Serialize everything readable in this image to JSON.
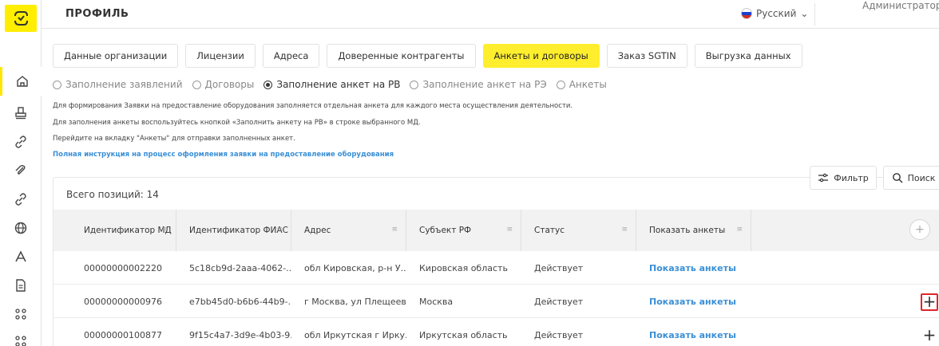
{
  "header": {
    "title": "ПРОФИЛЬ",
    "language": "Русский",
    "user": "Администратор"
  },
  "sidebar": {
    "icons": [
      "home-icon",
      "stamp-icon",
      "link-icon",
      "paperclip-icon",
      "link-icon",
      "globe-icon",
      "user-icon",
      "document-icon",
      "grid-icon",
      "grid-icon"
    ],
    "active_index": 0
  },
  "tabs": [
    {
      "label": "Данные организации",
      "active": false
    },
    {
      "label": "Лицензии",
      "active": false
    },
    {
      "label": "Адреса",
      "active": false
    },
    {
      "label": "Доверенные контрагенты",
      "active": false
    },
    {
      "label": "Анкеты и договоры",
      "active": true
    },
    {
      "label": "Заказ SGTIN",
      "active": false
    },
    {
      "label": "Выгрузка данных",
      "active": false
    }
  ],
  "radios": [
    {
      "label": "Заполнение заявлений",
      "checked": false
    },
    {
      "label": "Договоры",
      "checked": false
    },
    {
      "label": "Заполнение анкет на РВ",
      "checked": true
    },
    {
      "label": "Заполнение анкет на РЭ",
      "checked": false
    },
    {
      "label": "Анкеты",
      "checked": false
    }
  ],
  "info": {
    "line1": "Для формирования Заявки на предоставление оборудования заполняется отдельная анкета для каждого места осуществления деятельности.",
    "line2": "Для заполнения анкеты воспользуйтесь кнопкой «Заполнить анкету на РВ» в строке выбранного МД.",
    "line3": "Перейдите на вкладку \"Анкеты\" для отправки заполненных анкет.",
    "link": "Полная инструкция на процесс оформления заявки на предоставление оборудования"
  },
  "toolbar": {
    "filter": "Фильтр",
    "search": "Поиск"
  },
  "table": {
    "total": "Всего позиций: 14",
    "columns": [
      "Идентификатор МД",
      "Идентификатор ФИАС",
      "Адрес",
      "Субъект РФ",
      "Статус",
      "Показать анкеты"
    ],
    "rows": [
      {
        "md": "00000000002220",
        "fias": "5c18cb9d-2aaa-4062-...",
        "address": "обл Кировская, р-н У...",
        "subject": "Кировская область",
        "status": "Действует",
        "show": "Показать анкеты",
        "plus": false,
        "highlight": false
      },
      {
        "md": "00000000000976",
        "fias": "e7bb45d0-b6b6-44b9-...",
        "address": "г Москва, ул Плещеев...",
        "subject": "Москва",
        "status": "Действует",
        "show": "Показать анкеты",
        "plus": true,
        "highlight": true
      },
      {
        "md": "00000000100877",
        "fias": "9f15c4a7-3d9e-4b03-9...",
        "address": "обл Иркутская г Ирку...",
        "subject": "Иркутская область",
        "status": "Действует",
        "show": "Показать анкеты",
        "plus": true,
        "highlight": false
      }
    ],
    "plus_symbol": "+"
  },
  "colors": {
    "accent": "#ffee2e",
    "link": "#3a8fd6",
    "highlight": "#e0242c"
  }
}
